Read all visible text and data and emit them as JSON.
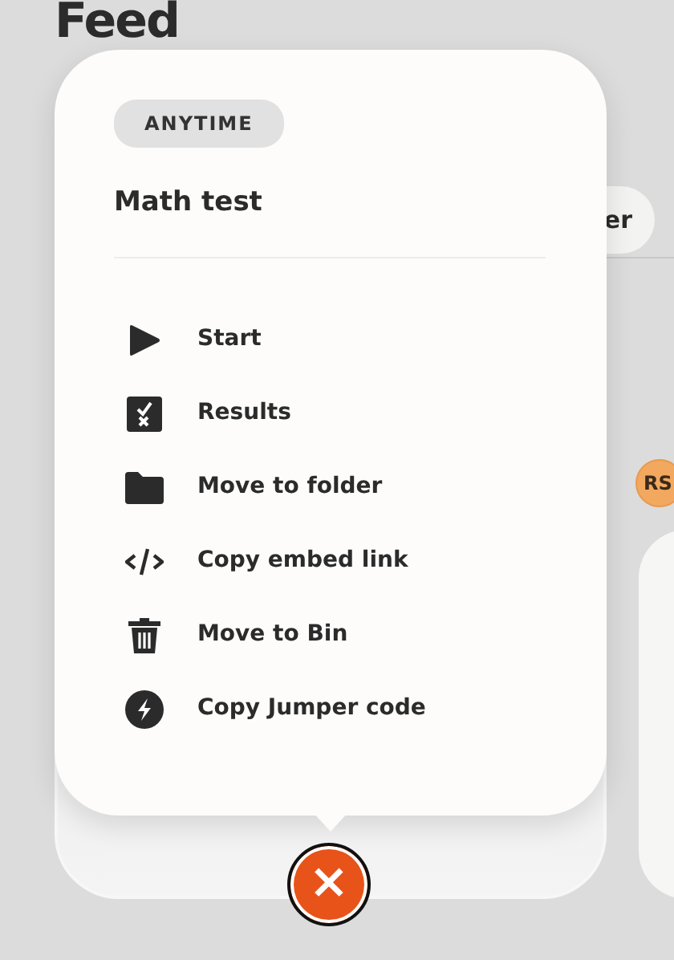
{
  "page": {
    "title": "Feed",
    "filter_button": "er",
    "avatar": "RS"
  },
  "popup": {
    "badge": "ANYTIME",
    "title": "Math test",
    "items": [
      {
        "label": "Start"
      },
      {
        "label": "Results"
      },
      {
        "label": "Move to folder"
      },
      {
        "label": "Copy embed link"
      },
      {
        "label": "Move to Bin"
      },
      {
        "label": "Copy Jumper code"
      }
    ]
  },
  "close_button": {
    "label": "×"
  }
}
